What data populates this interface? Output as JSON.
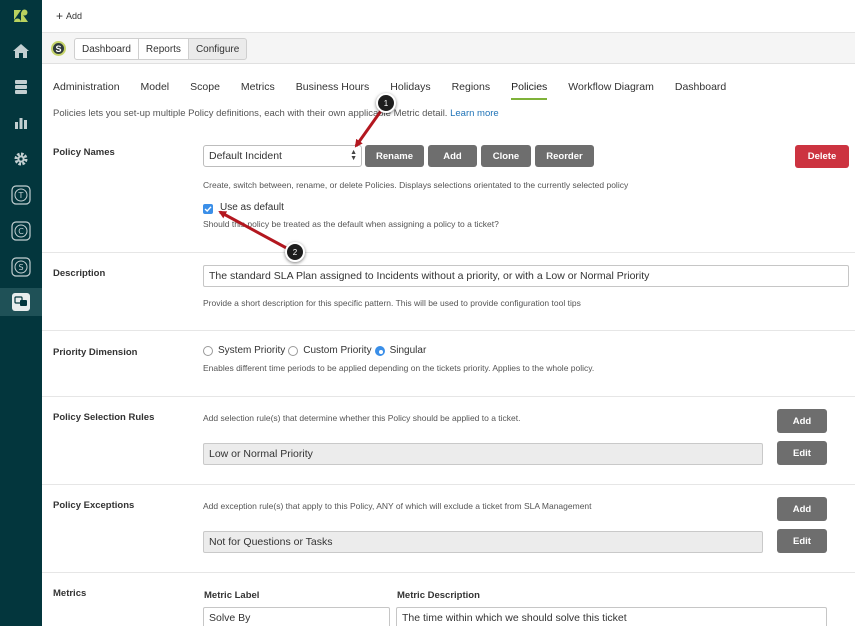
{
  "sidebar": {
    "icons": [
      "zendesk-logo-icon",
      "home-icon",
      "views-icon",
      "reporting-icon",
      "admin-gear-icon",
      "app-t-icon",
      "app-c-icon",
      "app-s-icon",
      "app-chat-icon"
    ]
  },
  "topbar": {
    "add_label": "Add",
    "add_glyph": "+"
  },
  "appbar": {
    "logo_letter": "S",
    "tabs": [
      "Dashboard",
      "Reports",
      "Configure"
    ],
    "active_tab": "Configure"
  },
  "nav": {
    "tabs": [
      "Administration",
      "Model",
      "Scope",
      "Metrics",
      "Business Hours",
      "Holidays",
      "Regions",
      "Policies",
      "Workflow Diagram",
      "Dashboard"
    ],
    "active": "Policies"
  },
  "intro": {
    "text": "Policies lets you set-up multiple Policy definitions, each with their own applicable Metric detail.",
    "link": "Learn more"
  },
  "policy_names": {
    "label": "Policy Names",
    "selected": "Default Incident",
    "buttons": {
      "rename": "Rename",
      "add": "Add",
      "clone": "Clone",
      "reorder": "Reorder",
      "delete": "Delete"
    },
    "hint": "Create, switch between, rename, or delete Policies. Displays selections orientated to the currently selected policy",
    "default_checkbox": {
      "label": "Use as default",
      "checked": true
    },
    "default_hint": "Should this policy be treated as the default when assigning a policy to a ticket?"
  },
  "description": {
    "label": "Description",
    "value": "The standard SLA Plan assigned to Incidents without a priority, or with a Low or Normal Priority",
    "hint": "Provide a short description for this specific pattern. This will be used to provide configuration tool tips"
  },
  "priority_dimension": {
    "label": "Priority Dimension",
    "options": [
      "System Priority",
      "Custom Priority",
      "Singular"
    ],
    "selected": "Singular",
    "hint": "Enables different time periods to be applied depending on the tickets priority. Applies to the whole policy."
  },
  "selection_rules": {
    "label": "Policy Selection Rules",
    "hint": "Add selection rule(s) that determine whether this Policy should be applied to a ticket.",
    "add_label": "Add",
    "rule": "Low or Normal Priority",
    "edit_label": "Edit"
  },
  "exceptions": {
    "label": "Policy Exceptions",
    "hint": "Add exception rule(s) that apply to this Policy, ANY of which will exclude a ticket from SLA Management",
    "add_label": "Add",
    "rule": "Not for Questions or Tasks",
    "edit_label": "Edit"
  },
  "metrics": {
    "label": "Metrics",
    "col_label": "Metric Label",
    "col_description": "Metric Description",
    "row_label": "Solve By",
    "row_description": "The time within which we should solve this ticket"
  },
  "callouts": [
    "1",
    "2"
  ],
  "colors": {
    "sidebar": "#03363d",
    "accent_green": "#7fb239",
    "delete_red": "#cc3340",
    "button_gray": "#6e6e6e",
    "link_blue": "#1f73b7",
    "checkbox_blue": "#3b8fe8",
    "arrow_red": "#b3171f"
  }
}
